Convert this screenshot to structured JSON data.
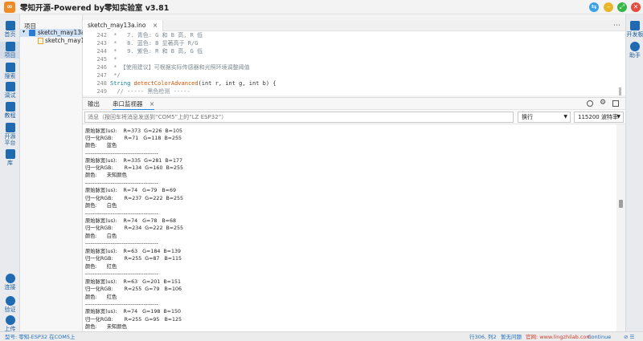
{
  "app": {
    "title": "零知开源-Powered by零知实验室 v3.81",
    "logo_glyph": "∞",
    "window_buttons": {
      "restore": "⇆",
      "minimize": "–",
      "maximize": "⤢",
      "close": "✕"
    },
    "window_colors": {
      "restore": "#3ba2e8",
      "minimize": "#e8b52a",
      "maximize": "#38b549",
      "close": "#e84a3d"
    }
  },
  "left_bar": [
    {
      "label": "首页",
      "icon": "home-icon"
    },
    {
      "label": "项目",
      "icon": "project-icon"
    },
    {
      "label": "搜索",
      "icon": "search-icon"
    },
    {
      "label": "调试",
      "icon": "debug-icon"
    },
    {
      "label": "教程",
      "icon": "tutorial-icon"
    },
    {
      "label": "开源平台",
      "icon": "opensource-icon"
    },
    {
      "label": "库",
      "icon": "library-icon"
    }
  ],
  "left_bar_bottom": [
    {
      "label": "连接",
      "icon": "connect-icon"
    },
    {
      "label": "验证",
      "icon": "verify-icon"
    },
    {
      "label": "上传",
      "icon": "upload-icon"
    }
  ],
  "right_bar": [
    {
      "label": "开发板",
      "icon": "board-icon"
    },
    {
      "label": "助手",
      "icon": "assistant-icon"
    }
  ],
  "project": {
    "title": "项目",
    "folder": "sketch_may13a",
    "file": "sketch_may13a"
  },
  "editor": {
    "tab": "sketch_may13a.ino",
    "tab_close": "×",
    "lines": [
      {
        "n": "242",
        "text": " *   7. 青色: G 和 B 高, R 低",
        "cls": "cm"
      },
      {
        "n": "243",
        "text": " *   8. 蓝色: B 显著高于 R/G",
        "cls": "cm"
      },
      {
        "n": "244",
        "text": " *   9. 紫色: R 和 B 高, G 低",
        "cls": "cm"
      },
      {
        "n": "245",
        "text": " *",
        "cls": "cm"
      },
      {
        "n": "246",
        "text": " * 【使用建议】可根据实际传感器和光照环境调整阈值",
        "cls": "cm"
      },
      {
        "n": "247",
        "text": " */",
        "cls": "cm"
      },
      {
        "n": "248",
        "text": "",
        "cls": "code"
      },
      {
        "n": "249",
        "text": "  // ----- 黑色检测 -----",
        "cls": "cm"
      }
    ],
    "line248": {
      "type": "String",
      "fn": "detectColorAdvanced",
      "args": "(int r, int g, int b) {"
    }
  },
  "panel": {
    "tab_output": "输出",
    "tab_serial": "串口监视器",
    "close": "×"
  },
  "serial": {
    "placeholder": "消息（按回车将消息发送到“COM5”上的“LZ ESP32”）",
    "line_ending": "换行",
    "baud": "115200 波特率"
  },
  "output_lines": [
    "原始脉宽(us):    R=373  G=226  B=105",
    "归一化RGB:       R=71   G=118  B=255",
    "颜色:      蓝色",
    "----------------------------------------",
    "原始脉宽(us):    R=335  G=281  B=177",
    "归一化RGB:       R=134  G=160  B=255",
    "颜色:      未知颜色",
    "----------------------------------------",
    "原始脉宽(us):    R=74   G=79   B=69",
    "归一化RGB:       R=237  G=222  B=255",
    "颜色:      白色",
    "----------------------------------------",
    "原始脉宽(us):    R=74   G=78   B=68",
    "归一化RGB:       R=234  G=222  B=255",
    "颜色:      白色",
    "----------------------------------------",
    "原始脉宽(us):    R=63   G=184  B=139",
    "归一化RGB:       R=255  G=87   B=115",
    "颜色:      红色",
    "----------------------------------------",
    "原始脉宽(us):    R=63   G=201  B=151",
    "归一化RGB:       R=255  G=79   B=106",
    "颜色:      红色",
    "----------------------------------------",
    "原始脉宽(us):    R=74   G=198  B=150",
    "归一化RGB:       R=255  G=95   B=125",
    "颜色:      未知颜色"
  ],
  "status": {
    "board": "型号: 零知-ESP32  在COM5上",
    "cursor": "行306, 列2",
    "updates": "暂无问题",
    "website": "官网: www.lingzhilab.com",
    "continue": "Continue",
    "icons": "⊘  ☰"
  }
}
